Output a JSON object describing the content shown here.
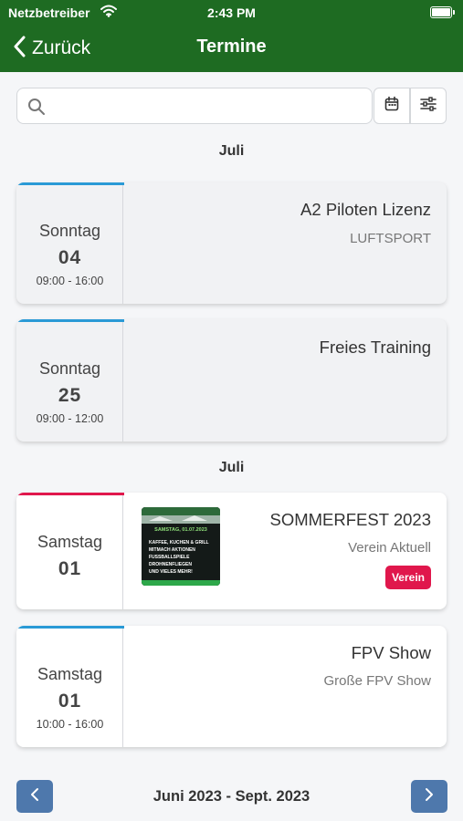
{
  "status": {
    "carrier": "Netzbetreiber",
    "time": "2:43 PM"
  },
  "nav": {
    "back_label": "Zurück",
    "title": "Termine"
  },
  "search": {
    "value": "",
    "placeholder": ""
  },
  "sections": [
    {
      "heading": "Juli",
      "events": [
        {
          "weekday": "Sonntag",
          "day": "04",
          "time": "09:00 - 16:00",
          "title": "A2 Piloten Lizenz",
          "subtitle": "LUFTSPORT",
          "accent": "#2a9ad6",
          "background": "#f1f2f4"
        },
        {
          "weekday": "Sonntag",
          "day": "25",
          "time": "09:00 - 12:00",
          "title": "Freies Training",
          "accent": "#2a9ad6",
          "background": "#f1f2f4"
        }
      ]
    },
    {
      "heading": "Juli",
      "events": [
        {
          "weekday": "Samstag",
          "day": "01",
          "title": "SOMMERFEST 2023",
          "subtitle": "Verein Aktuell",
          "tag": "Verein",
          "accent": "#e0174c",
          "background": "#ffffff",
          "flyer": {
            "header": "SAMSTAG, 01.07.2023",
            "lines": [
              "KAFFEE, KUCHEN & GRILL",
              "MITMACH AKTIONEN",
              "FUSSBALLSPIELE",
              "DROHNENFLIEGEN",
              "UND VIELES MEHR!"
            ]
          }
        },
        {
          "weekday": "Samstag",
          "day": "01",
          "time": "10:00 - 16:00",
          "title": "FPV Show",
          "subtitle": "Große FPV Show",
          "accent": "#2a9ad6",
          "background": "#ffffff"
        }
      ]
    }
  ],
  "pager": {
    "range_label": "Juni 2023 - Sept. 2023"
  },
  "colors": {
    "header": "#1e6b22",
    "pager_button": "#4e78ac",
    "tag": "#e0174c",
    "accent_blue": "#2a9ad6"
  },
  "icons": [
    "wifi-icon",
    "battery-icon",
    "chevron-left-icon",
    "search-icon",
    "calendar-icon",
    "sliders-icon",
    "chevron-right-icon"
  ]
}
